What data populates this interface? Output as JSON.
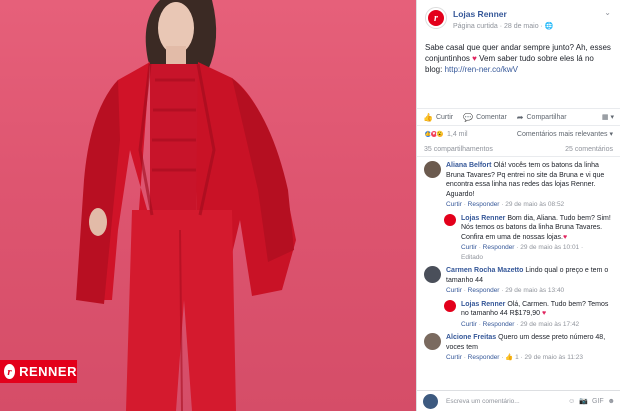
{
  "post": {
    "page_name": "Lojas Renner",
    "meta": "Página curtida · 28 de maio · 🌐",
    "text": "Sabe casal que quer andar sempre junto? Ah, esses conjuntinhos ",
    "text2": " Vem saber tudo sobre eles lá no blog: ",
    "link": "http://ren-ner.co/kwV",
    "heart": "♥",
    "photo_badge": "RENNER"
  },
  "actions": {
    "like": "Curtir",
    "comment": "Comentar",
    "share": "Compartilhar"
  },
  "reactions": {
    "count": "1,4 mil",
    "filter": "Comentários mais relevantes ▾"
  },
  "stats": {
    "shares": "35 compartilhamentos",
    "comments": "25 comentários"
  },
  "comments": [
    {
      "name": "Aliana Belfort",
      "text": "Olá! vocês tem os batons da linha Bruna Tavares? Pq entrei no site da Bruna e vi que encontra essa linha nas redes das lojas Renner. Aguardo!",
      "foot_like": "Curtir",
      "foot_reply": "Responder",
      "foot_time": "· 29 de maio às 08:52",
      "reply": {
        "name": "Lojas Renner",
        "text": "Bom dia, Aliana. Tudo bem? Sim! Nós temos os batons da linha Bruna Tavares. Confira em uma de nossas lojas.",
        "foot_like": "Curtir",
        "foot_reply": "Responder",
        "foot_time": "· 29 de maio às 10:01 ·",
        "edited": "Editado"
      }
    },
    {
      "name": "Carmen Rocha Mazetto",
      "text": "Lindo qual o preço e tem o tamanho 44",
      "foot_like": "Curtir",
      "foot_reply": "Responder",
      "foot_time": "· 29 de maio às 13:40",
      "reply": {
        "name": "Lojas Renner",
        "text": "Olá, Carmen. Tudo bem? Temos no tamanho 44 R$179,90",
        "foot_like": "Curtir",
        "foot_reply": "Responder",
        "foot_time": "· 29 de maio às 17:42",
        "edited": ""
      }
    },
    {
      "name": "Alcione Freitas",
      "text": "Quero um desse preto número 48, voces tem",
      "foot_like": "Curtir",
      "foot_reply": "Responder",
      "foot_time": "· 👍 1 · 29 de maio às 11:23",
      "reply": null
    }
  ],
  "composer": {
    "placeholder": "Escreva um comentário..."
  },
  "colors": {
    "brand_red": "#e3001b",
    "fb_link": "#365899",
    "photo_bg": "#de5570"
  }
}
